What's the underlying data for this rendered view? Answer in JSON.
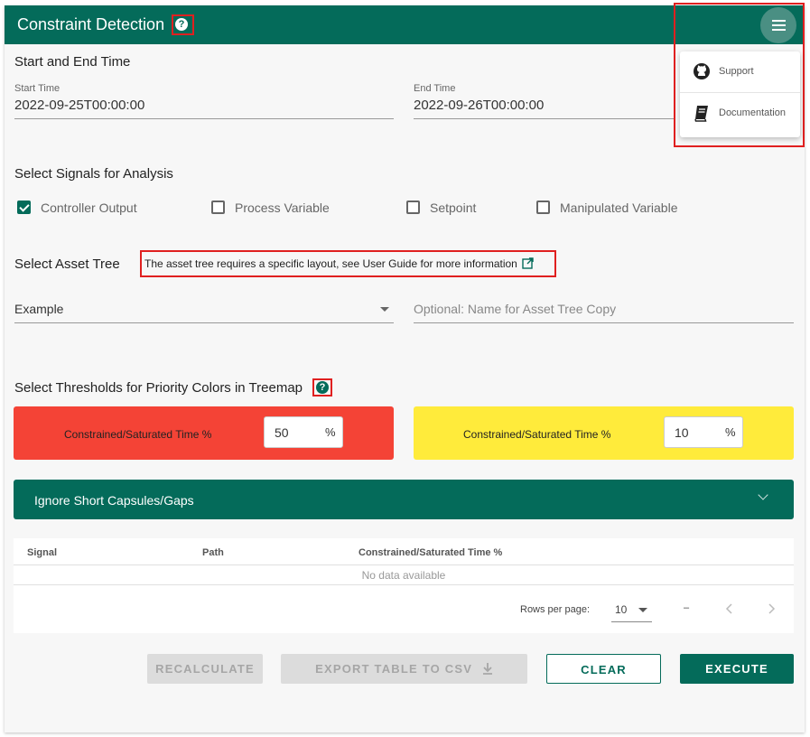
{
  "header": {
    "title": "Constraint Detection",
    "help_icon": "?"
  },
  "menu": {
    "items": [
      {
        "label": "Support",
        "icon": "github-icon"
      },
      {
        "label": "Documentation",
        "icon": "book-icon"
      }
    ]
  },
  "time": {
    "section_title": "Start and End Time",
    "start_label": "Start Time",
    "start_value": "2022-09-25T00:00:00",
    "end_label": "End Time",
    "end_value": "2022-09-26T00:00:00"
  },
  "signals": {
    "section_title": "Select Signals for Analysis",
    "options": [
      {
        "label": "Controller Output",
        "checked": true
      },
      {
        "label": "Process Variable",
        "checked": false
      },
      {
        "label": "Setpoint",
        "checked": false
      },
      {
        "label": "Manipulated Variable",
        "checked": false
      }
    ]
  },
  "asset_tree": {
    "section_title": "Select Asset Tree",
    "note": "The asset tree requires a specific layout, see User Guide for more information",
    "selected": "Example",
    "copy_name_placeholder": "Optional: Name for Asset Tree Copy"
  },
  "thresholds": {
    "section_title": "Select Thresholds for Priority Colors in Treemap",
    "red": {
      "label": "Constrained/Saturated Time %",
      "value": "50",
      "unit": "%",
      "color": "#f44336"
    },
    "yellow": {
      "label": "Constrained/Saturated Time %",
      "value": "10",
      "unit": "%",
      "color": "#ffeb3b"
    }
  },
  "ignore_panel": {
    "label": "Ignore Short Capsules/Gaps"
  },
  "table": {
    "columns": [
      "Signal",
      "Path",
      "Constrained/Saturated Time %"
    ],
    "empty_text": "No data available",
    "rows_per_page_label": "Rows per page:",
    "rows_per_page_value": "10",
    "range_text": "–"
  },
  "buttons": {
    "recalculate": "RECALCULATE",
    "export": "EXPORT TABLE TO CSV",
    "clear": "CLEAR",
    "execute": "EXECUTE"
  }
}
